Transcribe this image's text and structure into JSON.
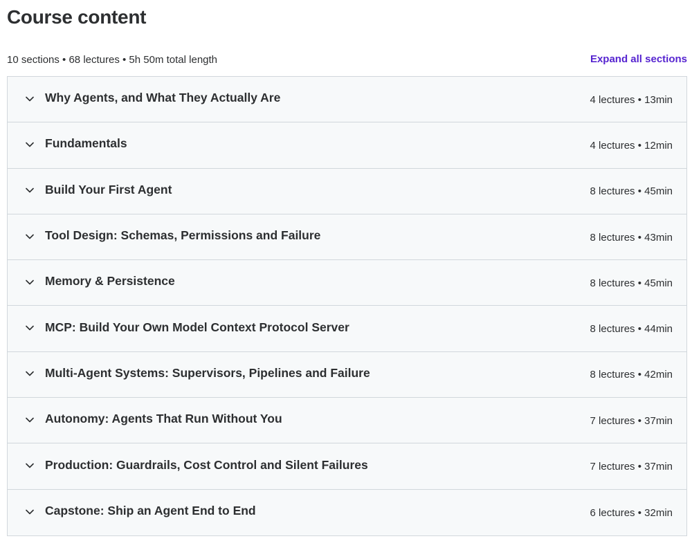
{
  "header": {
    "title": "Course content",
    "summary": "10 sections • 68 lectures • 5h 50m total length",
    "expand_label": "Expand all sections"
  },
  "sections": [
    {
      "title": "Why Agents, and What They Actually Are",
      "meta": "4 lectures • 13min"
    },
    {
      "title": "Fundamentals",
      "meta": "4 lectures • 12min"
    },
    {
      "title": "Build Your First Agent",
      "meta": "8 lectures • 45min"
    },
    {
      "title": "Tool Design: Schemas, Permissions and Failure",
      "meta": "8 lectures • 43min"
    },
    {
      "title": "Memory & Persistence",
      "meta": "8 lectures • 45min"
    },
    {
      "title": "MCP: Build Your Own Model Context Protocol Server",
      "meta": "8 lectures • 44min"
    },
    {
      "title": "Multi-Agent Systems: Supervisors, Pipelines and Failure",
      "meta": "8 lectures • 42min"
    },
    {
      "title": "Autonomy: Agents That Run Without You",
      "meta": "7 lectures • 37min"
    },
    {
      "title": "Production: Guardrails, Cost Control and Silent Failures",
      "meta": "7 lectures • 37min"
    },
    {
      "title": "Capstone: Ship an Agent End to End",
      "meta": "6 lectures • 32min"
    }
  ],
  "icons": {
    "section_toggle": "chevron-down-icon"
  },
  "colors": {
    "accent": "#5624d0",
    "text": "#2d2f31",
    "section_bg": "#f7f9fa",
    "border": "#d1d7dc"
  }
}
